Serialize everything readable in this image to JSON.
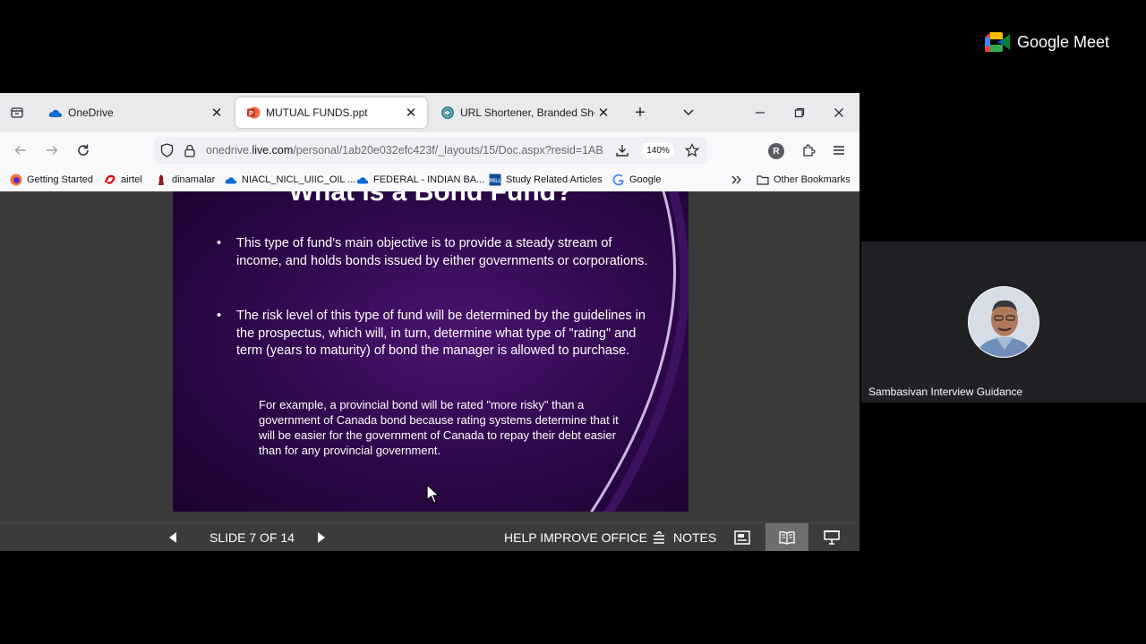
{
  "tabs": [
    {
      "title": "OneDrive",
      "icon": "onedrive-icon"
    },
    {
      "title": "MUTUAL FUNDS.ppt",
      "icon": "powerpoint-icon"
    },
    {
      "title": "URL Shortener, Branded Short Lin",
      "icon": "link-icon"
    }
  ],
  "url": {
    "prefix": "onedrive.",
    "domain": "live.com",
    "path": "/personal/1ab20e032efc423f/_layouts/15/Doc.aspx?resid=1AB"
  },
  "zoom": "140%",
  "profile_initial": "R",
  "bookmarks": [
    {
      "label": "Getting Started",
      "icon": "firefox-icon"
    },
    {
      "label": "airtel",
      "icon": "airtel-icon"
    },
    {
      "label": "dinamalar",
      "icon": "dinamalar-icon"
    },
    {
      "label": "NIACL_NICL_UIIC_OIL ...",
      "icon": "onedrive-icon"
    },
    {
      "label": "FEDERAL - INDIAN BA...",
      "icon": "onedrive-icon"
    },
    {
      "label": "Study Related Articles",
      "icon": "dell-icon"
    },
    {
      "label": "Google",
      "icon": "google-icon"
    }
  ],
  "other_bookmarks": "Other Bookmarks",
  "slide": {
    "title": "What is a Bond Fund?",
    "bullet1": "This type of fund's main objective is to provide a steady stream of income, and holds bonds issued by either governments or corporations.",
    "bullet2": "The risk level of this type of fund will be determined by the guidelines in the prospectus, which will, in turn, determine what type of \"rating\" and term (years to maturity) of bond the manager is allowed to purchase.",
    "example": "For example, a provincial bond will be rated \"more risky\" than a government of Canada bond because rating systems determine that it will be easier for the government of Canada to repay their debt easier than for any provincial government."
  },
  "status": {
    "slide_counter": "SLIDE 7 OF 14",
    "help": "HELP IMPROVE OFFICE",
    "notes": "NOTES"
  },
  "meet": {
    "brand": "Google Meet",
    "participant_name": "Sambasivan Interview Guidance"
  },
  "colors": {
    "ppt_red": "#c43e1c",
    "onedrive_blue": "#0a6ed1",
    "slide_purple": "#2c0848"
  }
}
